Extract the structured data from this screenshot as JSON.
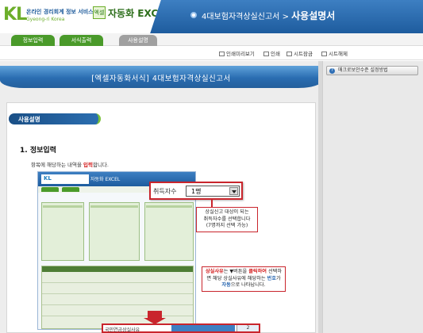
{
  "header": {
    "logo_mark": "KL",
    "logo_line1": "온라인 경리회계 정보 서비스",
    "logo_line2": "Gyeong-ri Korea",
    "app_badge": "엑셀",
    "app_name": "자동화 EXCEL",
    "title_prefix": "4대보험자격상실신고서",
    "title_separator": ">",
    "title_current": "사용설명서"
  },
  "tabs": [
    {
      "label": "정보입력"
    },
    {
      "label": "서식출력"
    },
    {
      "label": "사용설명"
    }
  ],
  "toolbar": {
    "preview": "인쇄미리보기",
    "print": "인쇄",
    "sheet_lock": "시트잠금",
    "sheet_unlock": "시트해제"
  },
  "document": {
    "band_title": "[엑셀자동화서식] 4대보험자격상실신고서",
    "section_label": "사용설명",
    "heading": "1. 정보입력",
    "desc_before": "항목에 해당하는 내역을 ",
    "desc_highlight": "입력",
    "desc_after": "합니다."
  },
  "screenshot": {
    "mini_logo": "KL",
    "mini_app": "자동화 EXCEL"
  },
  "callout_select": {
    "label": "취득자수",
    "value": "1명"
  },
  "note1": {
    "line1": "상실신고 대상이 되는",
    "line2": "취득자수를 선택합니다",
    "line3": "(7명까지 선택 가능)"
  },
  "note2": {
    "part1": "상실사유",
    "part2": "는 ▼버튼을 ",
    "part3": "클릭하여",
    "part4": " 선택하면 해당 상실사유에 해당하는 ",
    "part5": "번호",
    "part6": "가 ",
    "part7": "자동",
    "part8": "으로 나타납니다."
  },
  "bottom_strip": {
    "label": "국민연금상실사유",
    "number": "2"
  },
  "side": {
    "help_button": "매크로보안수준 설정방법",
    "help_icon": "?"
  }
}
